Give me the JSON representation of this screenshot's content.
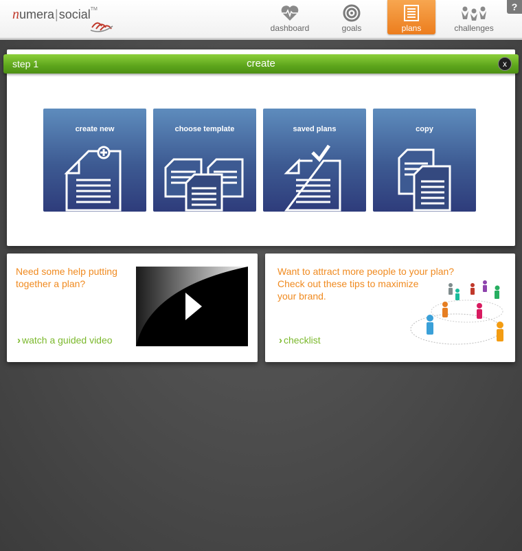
{
  "header": {
    "logo": {
      "n": "n",
      "umera": "umera",
      "social": "social",
      "tm": "TM"
    },
    "nav": [
      {
        "label": "dashboard",
        "icon": "heart-pulse-icon"
      },
      {
        "label": "goals",
        "icon": "target-icon"
      },
      {
        "label": "plans",
        "icon": "clipboard-list-icon",
        "active": true
      },
      {
        "label": "challenges",
        "icon": "people-group-icon"
      }
    ],
    "help_label": "?"
  },
  "step": {
    "label": "step 1",
    "title": "create",
    "close_label": "x",
    "tiles": [
      {
        "label": "create new",
        "icon": "new-document-icon"
      },
      {
        "label": "choose template",
        "icon": "template-documents-icon"
      },
      {
        "label": "saved plans",
        "icon": "saved-document-icon"
      },
      {
        "label": "copy",
        "icon": "copy-document-icon"
      }
    ]
  },
  "help_card": {
    "line1": "Need some help putting",
    "line2": "together a plan?",
    "link": "watch a guided video"
  },
  "tips_card": {
    "line1": "Want to attract more people to your plan?",
    "line2": "Check out these tips to maximize",
    "line3": "your brand.",
    "link": "checklist"
  },
  "colors": {
    "accent_orange": "#f08a1f",
    "accent_green": "#7bb82c",
    "step_green": "#5da51c",
    "tile_blue": "#3d5a92",
    "nav_active": "#ec7d1e"
  }
}
